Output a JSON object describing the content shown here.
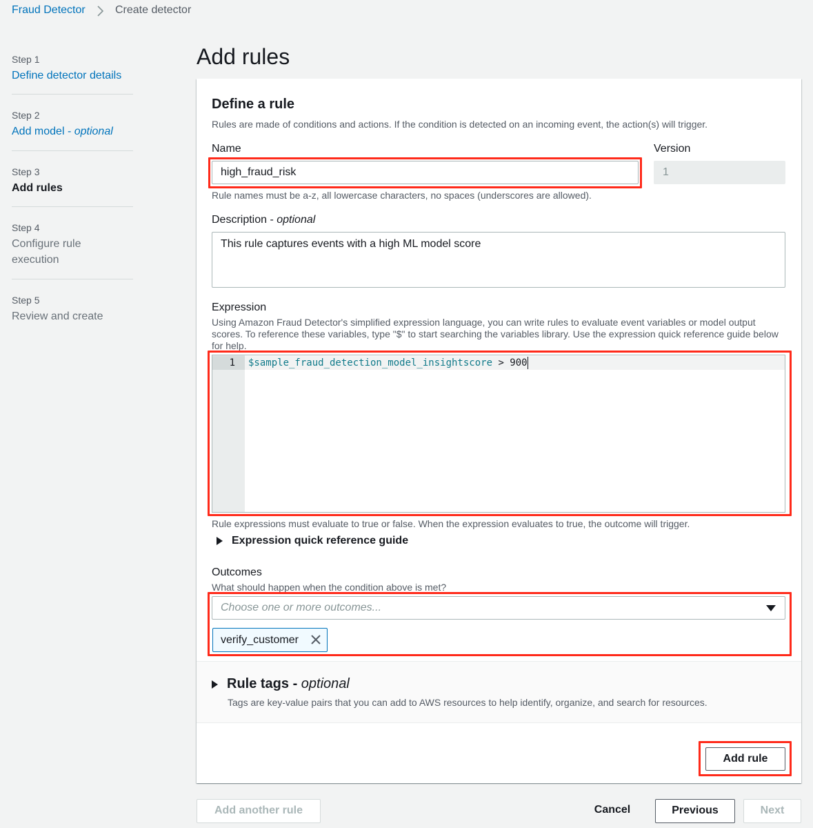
{
  "breadcrumb": {
    "items": [
      "Fraud Detector",
      "Create detector"
    ]
  },
  "steps": [
    {
      "num": "Step 1",
      "title": "Define detector details",
      "suffix": "",
      "state": "link"
    },
    {
      "num": "Step 2",
      "title": "Add model - ",
      "suffix": "optional",
      "state": "link"
    },
    {
      "num": "Step 3",
      "title": "Add rules",
      "suffix": "",
      "state": "current"
    },
    {
      "num": "Step 4",
      "title": "Configure rule execution",
      "suffix": "",
      "state": "disabled"
    },
    {
      "num": "Step 5",
      "title": "Review and create",
      "suffix": "",
      "state": "disabled"
    }
  ],
  "page": {
    "title": "Add rules"
  },
  "rule": {
    "heading": "Define a rule",
    "description": "Rules are made of conditions and actions. If the condition is detected on an incoming event, the action(s) will trigger.",
    "name": {
      "label": "Name",
      "value": "high_fraud_risk",
      "hint": "Rule names must be a-z, all lowercase characters, no spaces (underscores are allowed)."
    },
    "version": {
      "label": "Version",
      "value": "1"
    },
    "description_field": {
      "label": "Description - ",
      "label_suffix": "optional",
      "value": "This rule captures events with a high ML model score"
    },
    "expression": {
      "label": "Expression",
      "hint": "Using Amazon Fraud Detector's simplified expression language, you can write rules to evaluate event variables or model output scores. To reference these variables, type \"$\" to start searching the variables library. Use the expression quick reference guide below for help.",
      "line_number": "1",
      "code_variable": "$sample_fraud_detection_model_insightscore",
      "code_rest": " > 900",
      "footer_hint": "Rule expressions must evaluate to true or false. When the expression evaluates to true, the outcome will trigger.",
      "guide_label": "Expression quick reference guide"
    },
    "outcomes": {
      "label": "Outcomes",
      "hint": "What should happen when the condition above is met?",
      "placeholder": "Choose one or more outcomes...",
      "selected": [
        "verify_customer"
      ]
    },
    "tags": {
      "label": "Rule tags - ",
      "label_suffix": "optional",
      "hint": "Tags are key-value pairs that you can add to AWS resources to help identify, organize, and search for resources."
    },
    "add_rule_label": "Add rule"
  },
  "footer": {
    "add_another": "Add another rule",
    "cancel": "Cancel",
    "previous": "Previous",
    "next": "Next"
  },
  "colors": {
    "link": "#0073bb",
    "highlight": "#ff2a1a",
    "code_variable": "#107a8a"
  },
  "icons": [
    "chevron-right-icon",
    "caret-right-icon",
    "caret-down-icon",
    "close-icon"
  ]
}
